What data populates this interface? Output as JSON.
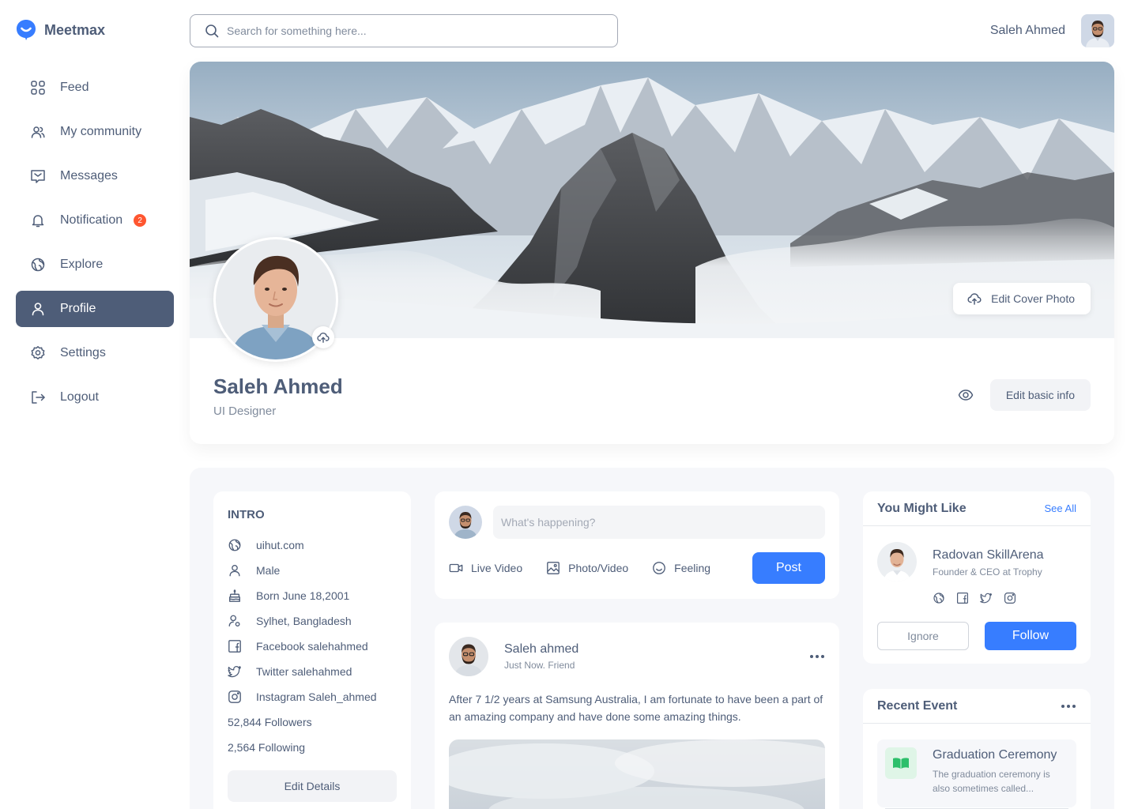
{
  "app": {
    "name": "Meetmax"
  },
  "sidebar": {
    "items": [
      {
        "label": "Feed",
        "icon": "grid-icon",
        "active": false
      },
      {
        "label": "My community",
        "icon": "community-icon",
        "active": false
      },
      {
        "label": "Messages",
        "icon": "message-icon",
        "active": false
      },
      {
        "label": "Notification",
        "icon": "bell-icon",
        "active": false,
        "badge": "2"
      },
      {
        "label": "Explore",
        "icon": "globe-icon",
        "active": false
      },
      {
        "label": "Profile",
        "icon": "user-icon",
        "active": true
      },
      {
        "label": "Settings",
        "icon": "gear-icon",
        "active": false
      },
      {
        "label": "Logout",
        "icon": "logout-icon",
        "active": false
      }
    ]
  },
  "search": {
    "placeholder": "Search for something here..."
  },
  "topbar": {
    "user_name": "Saleh Ahmed"
  },
  "profile": {
    "name": "Saleh Ahmed",
    "role": "UI Designer",
    "edit_cover_label": "Edit Cover Photo",
    "edit_basic_label": "Edit basic info"
  },
  "intro": {
    "title": "INTRO",
    "rows": [
      {
        "icon": "globe-icon",
        "text": "uihut.com"
      },
      {
        "icon": "user-icon",
        "text": "Male"
      },
      {
        "icon": "cake-icon",
        "text": "Born June 18,2001"
      },
      {
        "icon": "location-icon",
        "text": "Sylhet, Bangladesh"
      },
      {
        "icon": "facebook-icon",
        "text": "Facebook salehahmed"
      },
      {
        "icon": "twitter-icon",
        "text": "Twitter salehahmed"
      },
      {
        "icon": "instagram-icon",
        "text": "Instagram Saleh_ahmed"
      }
    ],
    "followers": "52,844 Followers",
    "following": "2,564 Following",
    "edit_label": "Edit Details"
  },
  "composer": {
    "placeholder": "What's happening?",
    "live_label": "Live Video",
    "photo_label": "Photo/Video",
    "feeling_label": "Feeling",
    "post_label": "Post"
  },
  "post": {
    "author": "Saleh ahmed",
    "meta": "Just Now. Friend",
    "text": "After 7 1/2 years at Samsung Australia, I am fortunate to have been a part of an amazing company and have done some amazing things."
  },
  "suggestions": {
    "title": "You Might Like",
    "see_all": "See All",
    "person_name": "Radovan SkillArena",
    "person_role": "Founder & CEO at Trophy",
    "ignore_label": "Ignore",
    "follow_label": "Follow"
  },
  "events": {
    "title": "Recent Event",
    "item_title": "Graduation Ceremony",
    "item_desc": "The graduation ceremony is also sometimes called..."
  },
  "colors": {
    "primary": "#377dff",
    "text": "#4e5d78",
    "muted": "#808b9c",
    "active_nav": "#4e5d78",
    "badge": "#ff5630"
  }
}
